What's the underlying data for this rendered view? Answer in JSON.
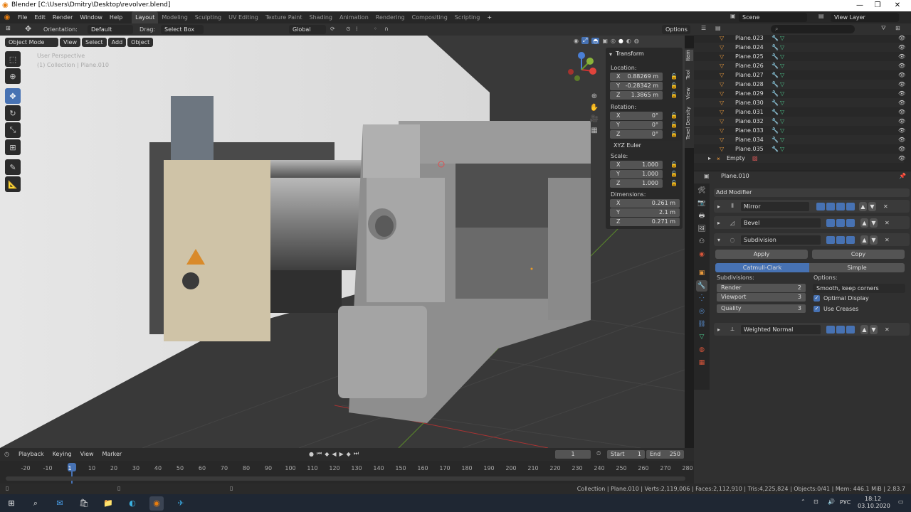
{
  "window": {
    "title": "Blender [C:\\Users\\Dmitry\\Desktop\\revolver.blend]",
    "min": "—",
    "max": "❐",
    "close": "✕"
  },
  "menu": {
    "items": [
      "File",
      "Edit",
      "Render",
      "Window",
      "Help"
    ]
  },
  "workspaces": [
    {
      "label": "Layout",
      "active": true
    },
    {
      "label": "Modeling",
      "active": false
    },
    {
      "label": "Sculpting",
      "active": false
    },
    {
      "label": "UV Editing",
      "active": false
    },
    {
      "label": "Texture Paint",
      "active": false
    },
    {
      "label": "Shading",
      "active": false
    },
    {
      "label": "Animation",
      "active": false
    },
    {
      "label": "Rendering",
      "active": false
    },
    {
      "label": "Compositing",
      "active": false
    },
    {
      "label": "Scripting",
      "active": false
    }
  ],
  "scene": {
    "name": "Scene",
    "view_layer": "View Layer"
  },
  "toolheader": {
    "orientation_label": "Orientation:",
    "orientation_value": "Default",
    "drag_label": "Drag:",
    "drag_value": "Select Box",
    "transform_space": "Global",
    "options": "Options"
  },
  "viewport_header": {
    "mode": "Object Mode",
    "view": "View",
    "select": "Select",
    "add": "Add",
    "object": "Object"
  },
  "viewport": {
    "overlay_line1": "User Perspective",
    "overlay_line2": "(1) Collection | Plane.010"
  },
  "npanel": {
    "title": "Transform",
    "location_label": "Location:",
    "location": [
      {
        "axis": "X",
        "value": "0.88269 m"
      },
      {
        "axis": "Y",
        "value": "-0.28342 m"
      },
      {
        "axis": "Z",
        "value": "1.3865 m"
      }
    ],
    "rotation_label": "Rotation:",
    "rotation": [
      {
        "axis": "X",
        "value": "0°"
      },
      {
        "axis": "Y",
        "value": "0°"
      },
      {
        "axis": "Z",
        "value": "0°"
      }
    ],
    "rotation_mode": "XYZ Euler",
    "scale_label": "Scale:",
    "scale": [
      {
        "axis": "X",
        "value": "1.000"
      },
      {
        "axis": "Y",
        "value": "1.000"
      },
      {
        "axis": "Z",
        "value": "1.000"
      }
    ],
    "dimensions_label": "Dimensions:",
    "dimensions": [
      {
        "axis": "X",
        "value": "0.261 m"
      },
      {
        "axis": "Y",
        "value": "2.1 m"
      },
      {
        "axis": "Z",
        "value": "0.271 m"
      }
    ],
    "tabs": [
      "Item",
      "Tool",
      "View",
      "Texel Density"
    ]
  },
  "outliner": {
    "items": [
      "Plane.023",
      "Plane.024",
      "Plane.025",
      "Plane.026",
      "Plane.027",
      "Plane.028",
      "Plane.029",
      "Plane.030",
      "Plane.031",
      "Plane.032",
      "Plane.033",
      "Plane.034",
      "Plane.035"
    ],
    "empty_label": "Empty"
  },
  "properties": {
    "object_name": "Plane.010",
    "add_modifier": "Add Modifier",
    "modifiers": [
      {
        "name": "Mirror",
        "expanded": false
      },
      {
        "name": "Bevel",
        "expanded": false
      },
      {
        "name": "Subdivision",
        "expanded": true
      },
      {
        "name": "Weighted Normal",
        "expanded": false
      }
    ],
    "apply": "Apply",
    "copy": "Copy",
    "catmull": "Catmull-Clark",
    "simple": "Simple",
    "subdivisions_label": "Subdivisions:",
    "render_label": "Render",
    "render_value": "2",
    "viewport_label": "Viewport",
    "viewport_value": "3",
    "quality_label": "Quality",
    "quality_value": "3",
    "options_label": "Options:",
    "uv_smooth": "Smooth, keep corners",
    "optimal_display": "Optimal Display",
    "use_creases": "Use Creases"
  },
  "timeline": {
    "playback": "Playback",
    "keying": "Keying",
    "view": "View",
    "marker": "Marker",
    "current_frame": "1",
    "start_label": "Start",
    "start": "1",
    "end_label": "End",
    "end": "250",
    "ruler": [
      "-20",
      "-10",
      "1",
      "10",
      "20",
      "30",
      "40",
      "50",
      "60",
      "70",
      "80",
      "90",
      "100",
      "110",
      "120",
      "130",
      "140",
      "150",
      "160",
      "170",
      "180",
      "190",
      "200",
      "210",
      "220",
      "230",
      "240",
      "250",
      "260",
      "270",
      "280"
    ]
  },
  "status": {
    "text": "Collection | Plane.010 | Verts:2,119,006 | Faces:2,112,910 | Tris:4,225,824 | Objects:0/41 | Mem: 446.1 MiB | 2.83.7"
  },
  "taskbar": {
    "lang": "РУС",
    "time": "18:12",
    "date": "03.10.2020"
  }
}
